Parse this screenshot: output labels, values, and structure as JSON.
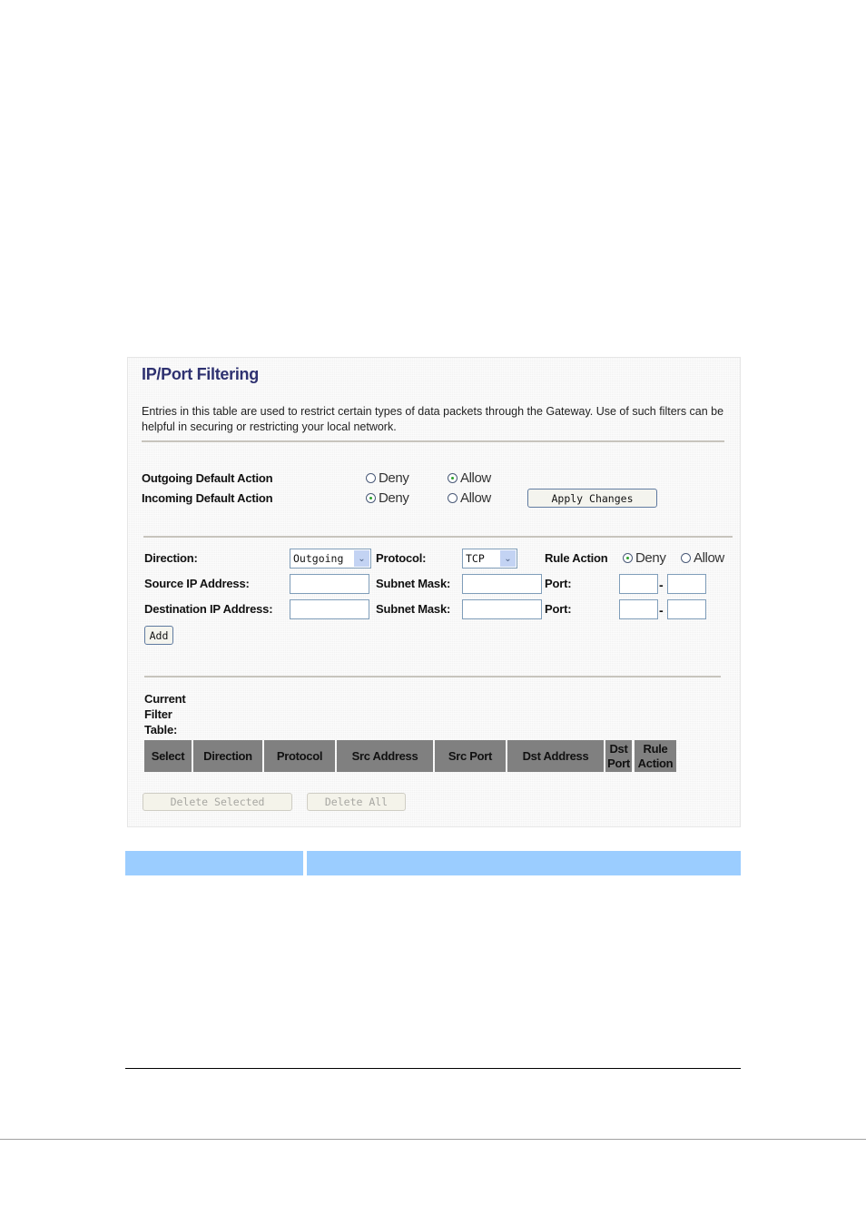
{
  "page": {
    "title": "IP/Port Filtering",
    "description": "Entries in this table are used to restrict certain types of data packets through the Gateway. Use of such filters can be helpful in securing or restricting your local network."
  },
  "default_actions": {
    "outgoing": {
      "label": "Outgoing Default Action",
      "options": [
        "Deny",
        "Allow"
      ],
      "selected": "Allow"
    },
    "incoming": {
      "label": "Incoming Default Action",
      "options": [
        "Deny",
        "Allow"
      ],
      "selected": "Deny"
    },
    "apply_button": "Apply Changes"
  },
  "rule_form": {
    "direction_label": "Direction:",
    "direction_value": "Outgoing",
    "protocol_label": "Protocol:",
    "protocol_value": "TCP",
    "rule_action_label": "Rule Action",
    "rule_action_options": [
      "Deny",
      "Allow"
    ],
    "rule_action_selected": "Deny",
    "source_ip_label": "Source IP Address:",
    "dest_ip_label": "Destination IP Address:",
    "subnet_mask_label": "Subnet Mask:",
    "port_label": "Port:",
    "port_separator": "-",
    "source_ip_value": "",
    "source_mask_value": "",
    "source_port_from": "",
    "source_port_to": "",
    "dest_ip_value": "",
    "dest_mask_value": "",
    "dest_port_from": "",
    "dest_port_to": "",
    "add_button": "Add"
  },
  "filter_table": {
    "label_lines": [
      "Current",
      "Filter",
      "Table:"
    ],
    "columns": [
      "Select",
      "Direction",
      "Protocol",
      "Src Address",
      "Src Port",
      "Dst Address",
      "Dst Port",
      "Rule Action"
    ],
    "rows": [],
    "delete_selected_button": "Delete Selected",
    "delete_all_button": "Delete All"
  },
  "colors": {
    "title": "#2e3170",
    "header_bg": "#808080",
    "blue_bar": "#9bcdff",
    "radio_selected": "#2ca12c"
  }
}
